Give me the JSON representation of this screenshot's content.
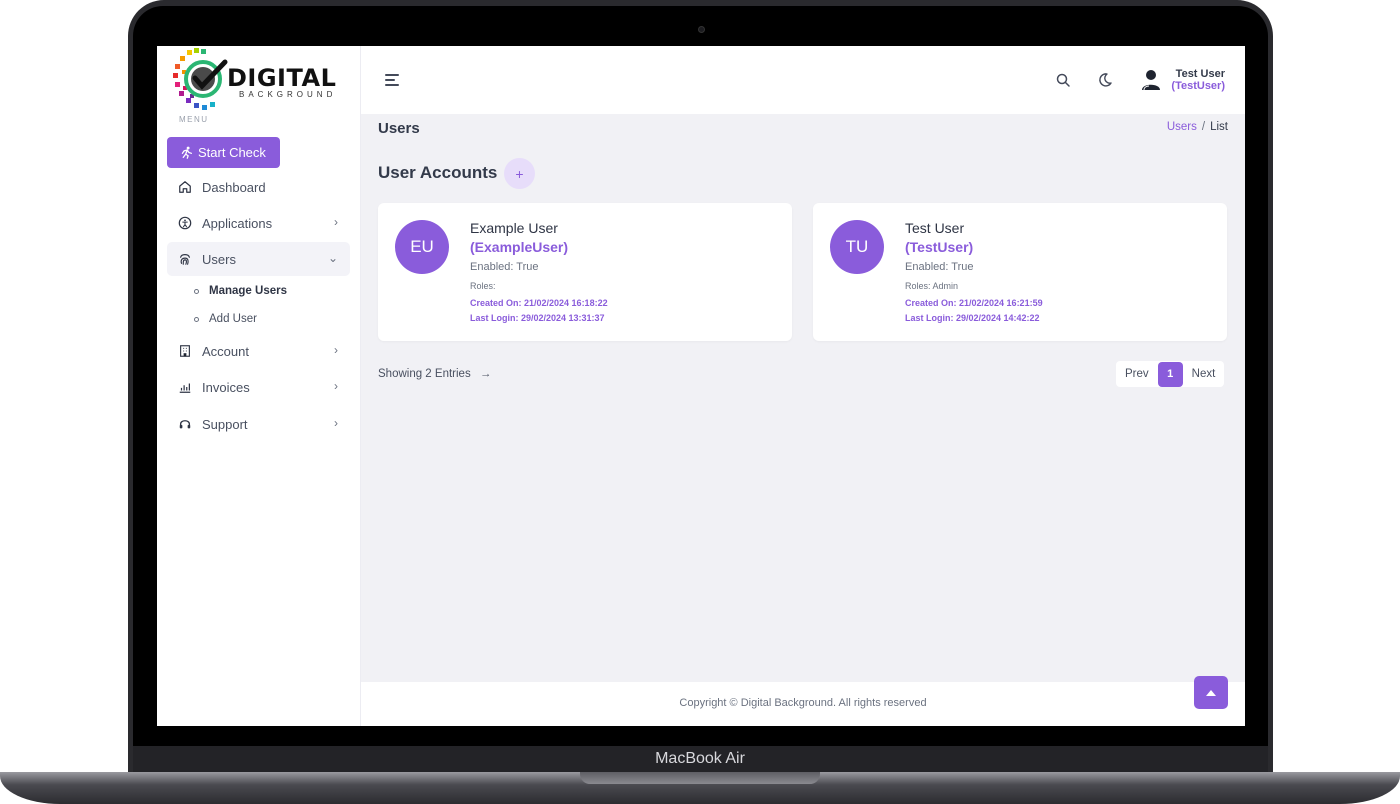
{
  "device": {
    "label": "MacBook Air"
  },
  "logo": {
    "title": "DIGITAL",
    "subtitle": "BACKGROUND"
  },
  "sidebar": {
    "menu_label": "MENU",
    "start_check": "Start Check",
    "items": [
      {
        "label": "Dashboard",
        "icon": "home-icon"
      },
      {
        "label": "Applications",
        "icon": "accessibility-icon"
      },
      {
        "label": "Users",
        "icon": "fingerprint-icon"
      },
      {
        "label": "Account",
        "icon": "building-icon"
      },
      {
        "label": "Invoices",
        "icon": "bar-chart-icon"
      },
      {
        "label": "Support",
        "icon": "headset-icon"
      }
    ],
    "users_sub": [
      {
        "label": "Manage Users"
      },
      {
        "label": "Add User"
      }
    ]
  },
  "header": {
    "user_name": "Test User",
    "user_handle": "(TestUser)"
  },
  "page": {
    "title": "Users",
    "breadcrumb": {
      "link": "Users",
      "separator": "/",
      "current": "List"
    },
    "section_title": "User Accounts",
    "add_label": "+"
  },
  "users": [
    {
      "initials": "EU",
      "name": "Example User",
      "handle": "(ExampleUser)",
      "enabled": "Enabled: True",
      "roles": "Roles:",
      "created": "Created On: 21/02/2024 16:18:22",
      "last_login": "Last Login: 29/02/2024 13:31:37"
    },
    {
      "initials": "TU",
      "name": "Test User",
      "handle": "(TestUser)",
      "enabled": "Enabled: True",
      "roles": "Roles: Admin",
      "created": "Created On: 21/02/2024 16:21:59",
      "last_login": "Last Login: 29/02/2024 14:42:22"
    }
  ],
  "pagination": {
    "showing": "Showing 2 Entries",
    "arrow": "→",
    "prev": "Prev",
    "current": "1",
    "next": "Next"
  },
  "footer": {
    "copyright": "Copyright © Digital Background. All rights reserved"
  },
  "colors": {
    "accent": "#8a5cdb",
    "background": "#f1f1f5"
  }
}
